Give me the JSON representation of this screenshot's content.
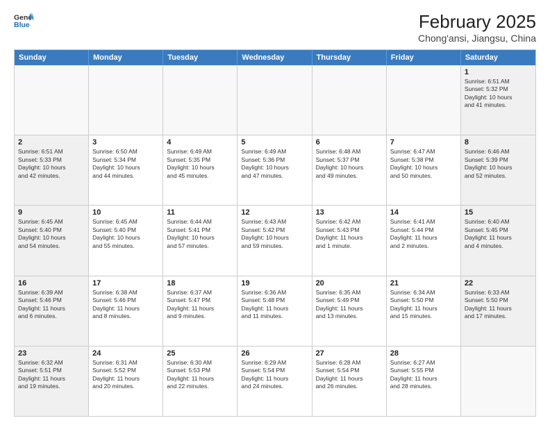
{
  "header": {
    "logo_line1": "General",
    "logo_line2": "Blue",
    "title": "February 2025",
    "subtitle": "Chong'ansi, Jiangsu, China"
  },
  "days_of_week": [
    "Sunday",
    "Monday",
    "Tuesday",
    "Wednesday",
    "Thursday",
    "Friday",
    "Saturday"
  ],
  "weeks": [
    [
      {
        "day": "",
        "info": "",
        "empty": true
      },
      {
        "day": "",
        "info": "",
        "empty": true
      },
      {
        "day": "",
        "info": "",
        "empty": true
      },
      {
        "day": "",
        "info": "",
        "empty": true
      },
      {
        "day": "",
        "info": "",
        "empty": true
      },
      {
        "day": "",
        "info": "",
        "empty": true
      },
      {
        "day": "1",
        "info": "Sunrise: 6:51 AM\nSunset: 5:32 PM\nDaylight: 10 hours\nand 41 minutes."
      }
    ],
    [
      {
        "day": "2",
        "info": "Sunrise: 6:51 AM\nSunset: 5:33 PM\nDaylight: 10 hours\nand 42 minutes."
      },
      {
        "day": "3",
        "info": "Sunrise: 6:50 AM\nSunset: 5:34 PM\nDaylight: 10 hours\nand 44 minutes."
      },
      {
        "day": "4",
        "info": "Sunrise: 6:49 AM\nSunset: 5:35 PM\nDaylight: 10 hours\nand 45 minutes."
      },
      {
        "day": "5",
        "info": "Sunrise: 6:49 AM\nSunset: 5:36 PM\nDaylight: 10 hours\nand 47 minutes."
      },
      {
        "day": "6",
        "info": "Sunrise: 6:48 AM\nSunset: 5:37 PM\nDaylight: 10 hours\nand 49 minutes."
      },
      {
        "day": "7",
        "info": "Sunrise: 6:47 AM\nSunset: 5:38 PM\nDaylight: 10 hours\nand 50 minutes."
      },
      {
        "day": "8",
        "info": "Sunrise: 6:46 AM\nSunset: 5:39 PM\nDaylight: 10 hours\nand 52 minutes."
      }
    ],
    [
      {
        "day": "9",
        "info": "Sunrise: 6:45 AM\nSunset: 5:40 PM\nDaylight: 10 hours\nand 54 minutes."
      },
      {
        "day": "10",
        "info": "Sunrise: 6:45 AM\nSunset: 5:40 PM\nDaylight: 10 hours\nand 55 minutes."
      },
      {
        "day": "11",
        "info": "Sunrise: 6:44 AM\nSunset: 5:41 PM\nDaylight: 10 hours\nand 57 minutes."
      },
      {
        "day": "12",
        "info": "Sunrise: 6:43 AM\nSunset: 5:42 PM\nDaylight: 10 hours\nand 59 minutes."
      },
      {
        "day": "13",
        "info": "Sunrise: 6:42 AM\nSunset: 5:43 PM\nDaylight: 11 hours\nand 1 minute."
      },
      {
        "day": "14",
        "info": "Sunrise: 6:41 AM\nSunset: 5:44 PM\nDaylight: 11 hours\nand 2 minutes."
      },
      {
        "day": "15",
        "info": "Sunrise: 6:40 AM\nSunset: 5:45 PM\nDaylight: 11 hours\nand 4 minutes."
      }
    ],
    [
      {
        "day": "16",
        "info": "Sunrise: 6:39 AM\nSunset: 5:46 PM\nDaylight: 11 hours\nand 6 minutes."
      },
      {
        "day": "17",
        "info": "Sunrise: 6:38 AM\nSunset: 5:46 PM\nDaylight: 11 hours\nand 8 minutes."
      },
      {
        "day": "18",
        "info": "Sunrise: 6:37 AM\nSunset: 5:47 PM\nDaylight: 11 hours\nand 9 minutes."
      },
      {
        "day": "19",
        "info": "Sunrise: 6:36 AM\nSunset: 5:48 PM\nDaylight: 11 hours\nand 11 minutes."
      },
      {
        "day": "20",
        "info": "Sunrise: 6:35 AM\nSunset: 5:49 PM\nDaylight: 11 hours\nand 13 minutes."
      },
      {
        "day": "21",
        "info": "Sunrise: 6:34 AM\nSunset: 5:50 PM\nDaylight: 11 hours\nand 15 minutes."
      },
      {
        "day": "22",
        "info": "Sunrise: 6:33 AM\nSunset: 5:50 PM\nDaylight: 11 hours\nand 17 minutes."
      }
    ],
    [
      {
        "day": "23",
        "info": "Sunrise: 6:32 AM\nSunset: 5:51 PM\nDaylight: 11 hours\nand 19 minutes."
      },
      {
        "day": "24",
        "info": "Sunrise: 6:31 AM\nSunset: 5:52 PM\nDaylight: 11 hours\nand 20 minutes."
      },
      {
        "day": "25",
        "info": "Sunrise: 6:30 AM\nSunset: 5:53 PM\nDaylight: 11 hours\nand 22 minutes."
      },
      {
        "day": "26",
        "info": "Sunrise: 6:29 AM\nSunset: 5:54 PM\nDaylight: 11 hours\nand 24 minutes."
      },
      {
        "day": "27",
        "info": "Sunrise: 6:28 AM\nSunset: 5:54 PM\nDaylight: 11 hours\nand 26 minutes."
      },
      {
        "day": "28",
        "info": "Sunrise: 6:27 AM\nSunset: 5:55 PM\nDaylight: 11 hours\nand 28 minutes."
      },
      {
        "day": "",
        "info": "",
        "empty": true
      }
    ]
  ]
}
